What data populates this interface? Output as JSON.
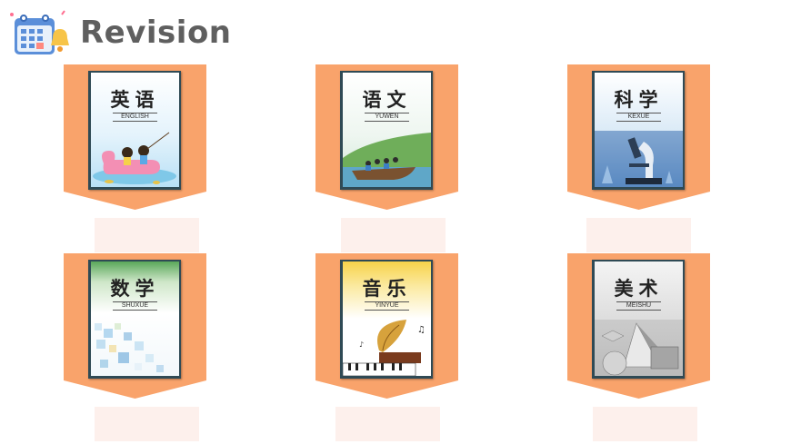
{
  "header": {
    "title": "Revision",
    "icon": "calendar-bell-icon"
  },
  "colors": {
    "ribbon": "#f9a36b",
    "label_box": "#fdf0ec",
    "title": "#5f5f5f"
  },
  "books": [
    {
      "chinese": "英语",
      "pinyin": "ENGLISH",
      "art": "kids-on-duck-boat"
    },
    {
      "chinese": "语文",
      "pinyin": "YUWEN",
      "art": "boat-on-river"
    },
    {
      "chinese": "科学",
      "pinyin": "KEXUE",
      "art": "microscope"
    },
    {
      "chinese": "数学",
      "pinyin": "SHUXUE",
      "art": "colored-squares"
    },
    {
      "chinese": "音乐",
      "pinyin": "YINYUE",
      "art": "gramophone-piano"
    },
    {
      "chinese": "美术",
      "pinyin": "MEISHU",
      "art": "geometric-sketch"
    }
  ]
}
